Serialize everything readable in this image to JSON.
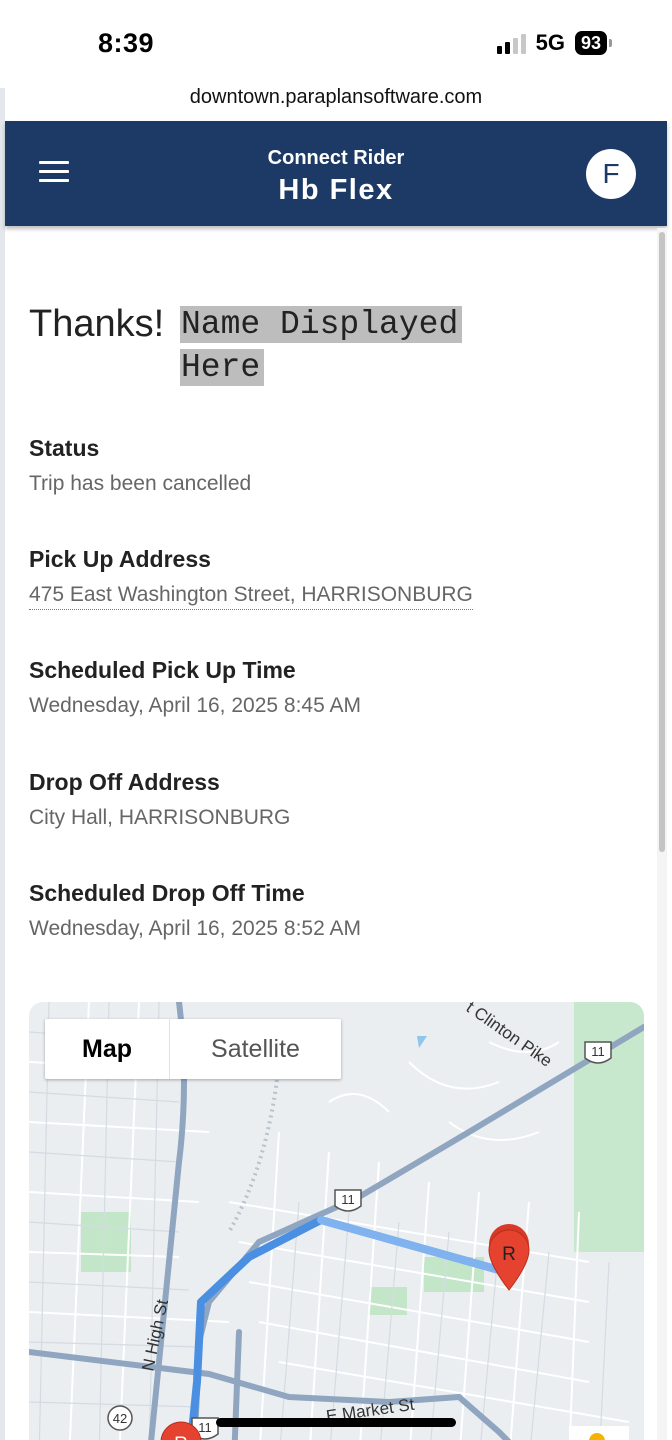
{
  "status_bar": {
    "time": "8:39",
    "network": "5G",
    "battery": "93"
  },
  "browser": {
    "url": "downtown.paraplansoftware.com"
  },
  "header": {
    "subtitle": "Connect Rider",
    "title": "Hb Flex",
    "avatar_initial": "F"
  },
  "greeting": {
    "thanks": "Thanks!",
    "name_line1": "Name Displayed",
    "name_line2": "Here"
  },
  "trip": {
    "status_label": "Status",
    "status_value": "Trip has been cancelled",
    "pickup_address_label": "Pick Up Address",
    "pickup_address_value": "475 East Washington Street, HARRISONBURG",
    "pickup_time_label": "Scheduled Pick Up Time",
    "pickup_time_value": "Wednesday, April 16, 2025 8:45 AM",
    "dropoff_address_label": "Drop Off Address",
    "dropoff_address_value": "City Hall, HARRISONBURG",
    "dropoff_time_label": "Scheduled Drop Off Time",
    "dropoff_time_value": "Wednesday, April 16, 2025 8:52 AM"
  },
  "map": {
    "map_tab": "Map",
    "satellite_tab": "Satellite",
    "labels": {
      "clinton_pike": "t Clinton Pike",
      "high_st": "N High St",
      "market_st": "E Market St",
      "route_11a": "11",
      "route_11b": "11",
      "route_11c": "11",
      "route_42": "42",
      "pickup_marker": "R",
      "dropoff_marker": "R"
    },
    "colors": {
      "route": "#4a8fe2",
      "marker": "#e5432f",
      "road": "#8fa5c0",
      "park": "#b9e4c1"
    }
  }
}
